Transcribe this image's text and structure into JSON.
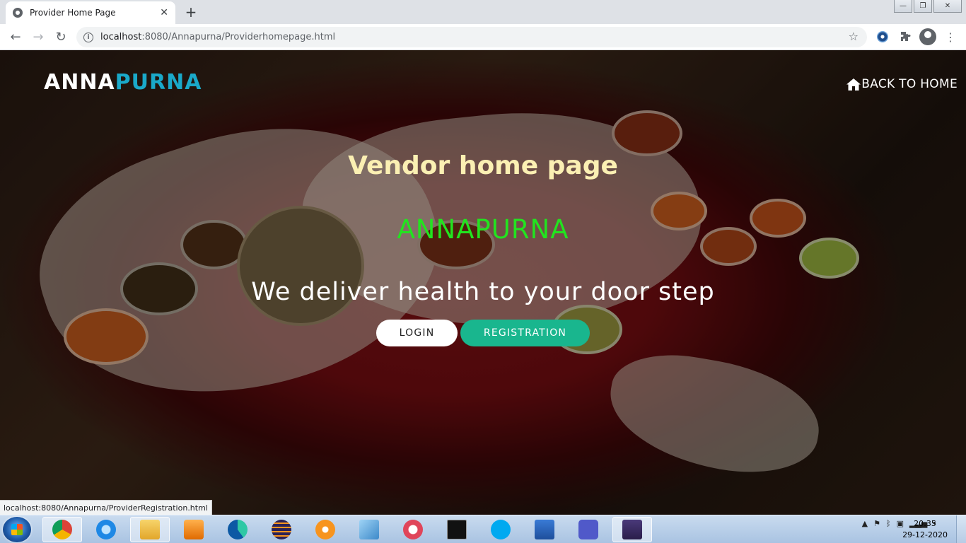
{
  "browser": {
    "tab_title": "Provider Home Page",
    "tab_close": "✕",
    "new_tab": "+",
    "url_host": "localhost",
    "url_rest": ":8080/Annapurna/Providerhomepage.html",
    "status_url": "localhost:8080/Annapurna/ProviderRegistration.html",
    "window_controls": [
      "—",
      "❐",
      "✕"
    ]
  },
  "nav": {
    "back": "←",
    "forward": "→",
    "reload": "↻",
    "star": "☆",
    "menu": "⋮"
  },
  "header": {
    "brand_part1": "ANNA",
    "brand_part2": "PURNA",
    "back_home": "BACK TO HOME"
  },
  "hero": {
    "title": "Vendor home page",
    "brand": "ANNAPURNA",
    "tagline": "We deliver health to your door step"
  },
  "buttons": {
    "login": "LOGIN",
    "registration": "REGISTRATION"
  },
  "taskbar": {
    "apps": [
      "chrome",
      "internet-explorer",
      "file-explorer",
      "media-player",
      "edge",
      "eclipse",
      "app-orange",
      "paint-tool",
      "snipping-tool",
      "command-prompt",
      "skype",
      "word",
      "teams",
      "java-ee-ide"
    ],
    "time": "20:35",
    "date": "29-12-2020"
  },
  "colors": {
    "brand_accent": "#1aa9c9",
    "hero_title": "#fbf0b3",
    "hero_brand": "#22e41f",
    "registration_button": "#19b68e"
  }
}
